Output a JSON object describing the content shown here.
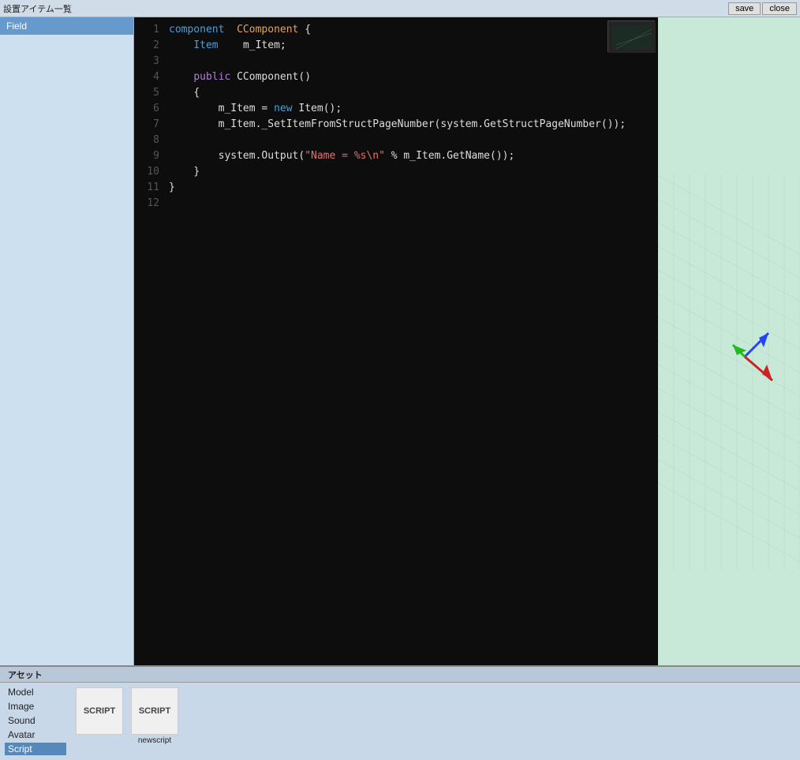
{
  "topbar": {
    "title": "設置アイテム一覧",
    "save_label": "save",
    "close_label": "close"
  },
  "sidebar": {
    "items": [
      {
        "label": "Field",
        "selected": true
      }
    ]
  },
  "code": {
    "lines": [
      {
        "num": 1,
        "tokens": [
          {
            "t": "component",
            "c": "kw-blue"
          },
          {
            "t": "  ",
            "c": ""
          },
          {
            "t": "CComponent",
            "c": "kw-orange"
          },
          {
            "t": " {",
            "c": "kw-white"
          }
        ]
      },
      {
        "num": 2,
        "tokens": [
          {
            "t": "    Item",
            "c": "kw-blue"
          },
          {
            "t": "    m_Item;",
            "c": "kw-white"
          }
        ]
      },
      {
        "num": 3,
        "tokens": []
      },
      {
        "num": 4,
        "tokens": [
          {
            "t": "    ",
            "c": ""
          },
          {
            "t": "public",
            "c": "kw-purple"
          },
          {
            "t": " CComponent()",
            "c": "kw-white"
          }
        ]
      },
      {
        "num": 5,
        "tokens": [
          {
            "t": "    {",
            "c": "kw-white"
          }
        ]
      },
      {
        "num": 6,
        "tokens": [
          {
            "t": "        m_Item",
            "c": "kw-white"
          },
          {
            "t": " = ",
            "c": "kw-white"
          },
          {
            "t": "new",
            "c": "kw-blue"
          },
          {
            "t": " Item();",
            "c": "kw-white"
          }
        ]
      },
      {
        "num": 7,
        "tokens": [
          {
            "t": "        m_Item._SetItemFromStructPageNumber(system.GetStructPageNumber());",
            "c": "kw-white"
          }
        ]
      },
      {
        "num": 8,
        "tokens": []
      },
      {
        "num": 9,
        "tokens": [
          {
            "t": "        system.Output(",
            "c": "kw-white"
          },
          {
            "t": "\"Name = %s\\n\"",
            "c": "kw-string"
          },
          {
            "t": " % m_Item.GetName());",
            "c": "kw-white"
          }
        ]
      },
      {
        "num": 10,
        "tokens": [
          {
            "t": "    }",
            "c": "kw-white"
          }
        ]
      },
      {
        "num": 11,
        "tokens": [
          {
            "t": "}",
            "c": "kw-white"
          }
        ]
      },
      {
        "num": 12,
        "tokens": []
      }
    ]
  },
  "bottom": {
    "panel_label": "アセット",
    "nav_items": [
      {
        "label": "Model",
        "selected": false
      },
      {
        "label": "Image",
        "selected": false
      },
      {
        "label": "Sound",
        "selected": false
      },
      {
        "label": "Avatar",
        "selected": false
      },
      {
        "label": "Script",
        "selected": true
      }
    ],
    "assets": [
      {
        "icon": "SCRIPT",
        "label": ""
      },
      {
        "icon": "SCRIPT",
        "label": "newscript"
      }
    ]
  }
}
